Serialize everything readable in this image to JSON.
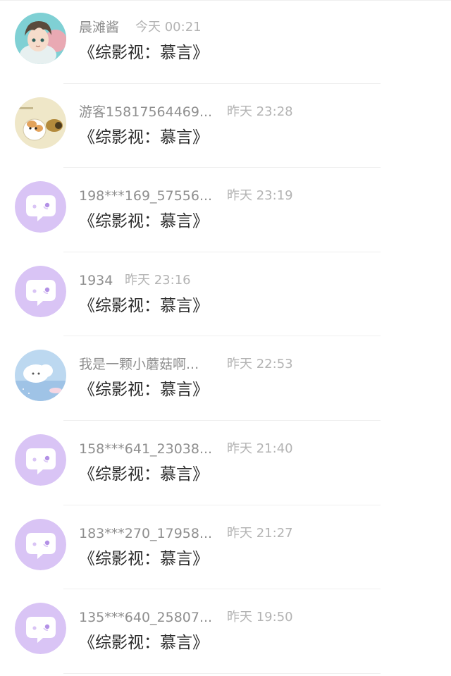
{
  "comments": [
    {
      "name": "晨滩酱",
      "time": "今天 00:21",
      "text": "《综影视：慕言》",
      "avatar": "anime-boy-avatar"
    },
    {
      "name": "游客15817564469...",
      "time": "昨天 23:28",
      "text": "《综影视：慕言》",
      "avatar": "hamster-avatar"
    },
    {
      "name": "198***169_57556...",
      "time": "昨天 23:19",
      "text": "《综影视：慕言》",
      "avatar": "default-chat-bubble-avatar"
    },
    {
      "name": "1934",
      "time": "昨天 23:16",
      "text": "《综影视：慕言》",
      "avatar": "default-chat-bubble-avatar"
    },
    {
      "name": "我是一颗小蘑菇啊...",
      "time": "昨天 22:53",
      "text": "《综影视：慕言》",
      "avatar": "sky-cloud-avatar"
    },
    {
      "name": "158***641_23038...",
      "time": "昨天 21:40",
      "text": "《综影视：慕言》",
      "avatar": "default-chat-bubble-avatar"
    },
    {
      "name": "183***270_17958...",
      "time": "昨天 21:27",
      "text": "《综影视：慕言》",
      "avatar": "default-chat-bubble-avatar"
    },
    {
      "name": "135***640_25807...",
      "time": "昨天 19:50",
      "text": "《综影视：慕言》",
      "avatar": "default-chat-bubble-avatar"
    }
  ],
  "colors": {
    "default_avatar_bg": "#d9c4f5",
    "default_avatar_bubble": "#ffffff",
    "name_text": "#8f8f8f",
    "time_text": "#b3b3b3",
    "message_text": "#2b2b2b"
  }
}
